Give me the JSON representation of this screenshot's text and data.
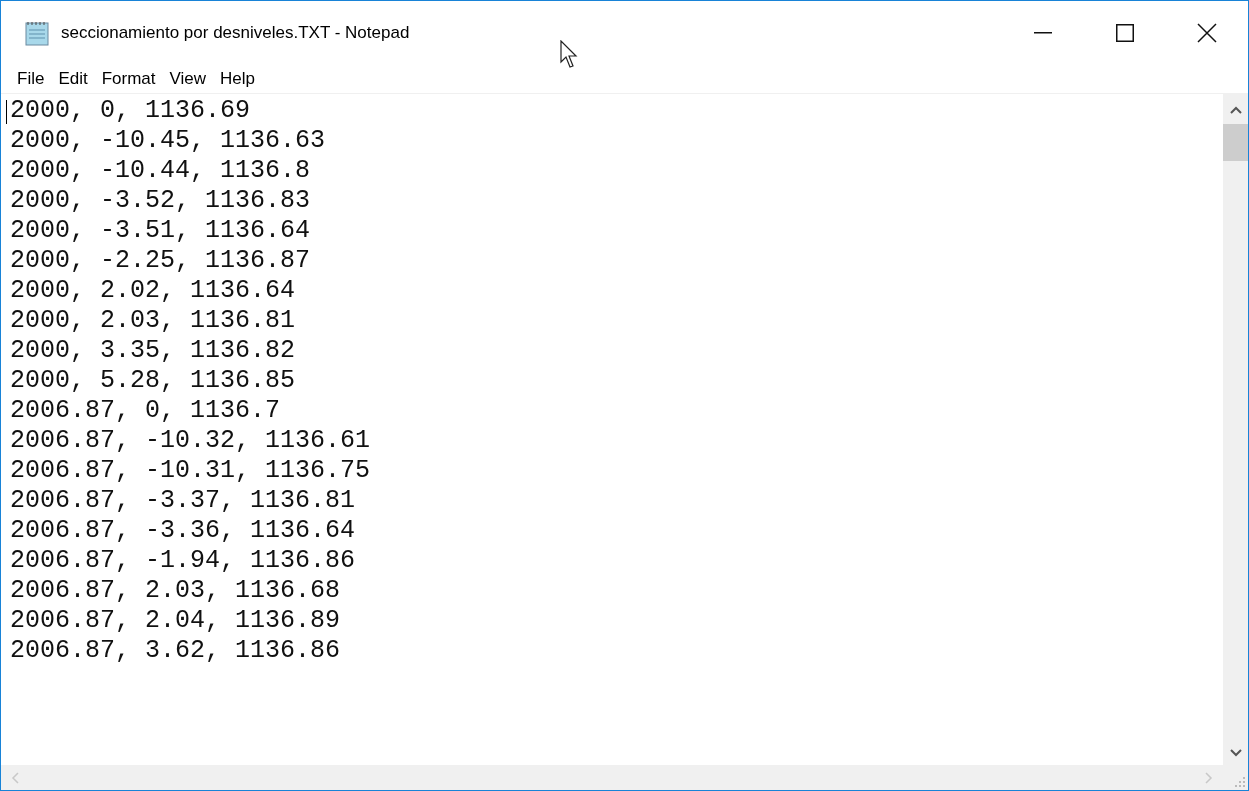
{
  "window": {
    "title": "seccionamiento por desniveles.TXT - Notepad"
  },
  "menu": [
    "File",
    "Edit",
    "Format",
    "View",
    "Help"
  ],
  "lines": [
    "2000, 0, 1136.69",
    "2000, -10.45, 1136.63",
    "2000, -10.44, 1136.8",
    "2000, -3.52, 1136.83",
    "2000, -3.51, 1136.64",
    "2000, -2.25, 1136.87",
    "2000, 2.02, 1136.64",
    "2000, 2.03, 1136.81",
    "2000, 3.35, 1136.82",
    "2000, 5.28, 1136.85",
    "2006.87, 0, 1136.7",
    "2006.87, -10.32, 1136.61",
    "2006.87, -10.31, 1136.75",
    "2006.87, -3.37, 1136.81",
    "2006.87, -3.36, 1136.64",
    "2006.87, -1.94, 1136.86",
    "2006.87, 2.03, 1136.68",
    "2006.87, 2.04, 1136.89",
    "2006.87, 3.62, 1136.86"
  ]
}
